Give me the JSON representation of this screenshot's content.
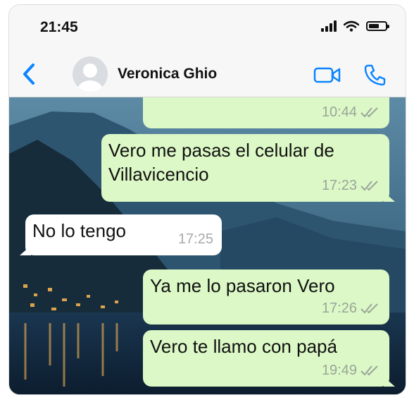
{
  "status_bar": {
    "time": "21:45"
  },
  "header": {
    "contact_name": "Veronica Ghio"
  },
  "colors": {
    "accent": "#0a84ff",
    "outgoing_bubble": "#dcf8c6",
    "incoming_bubble": "#ffffff"
  },
  "icons": [
    "back-chevron-icon",
    "avatar-placeholder-icon",
    "video-call-icon",
    "phone-call-icon",
    "signal-icon",
    "wifi-icon",
    "battery-icon",
    "double-check-icon"
  ],
  "messages": [
    {
      "direction": "out",
      "text": "",
      "time": "10:44",
      "read": true
    },
    {
      "direction": "out",
      "text": "Vero me pasas el celular de Villavicencio",
      "time": "17:23",
      "read": true
    },
    {
      "direction": "in",
      "text": "No lo tengo",
      "time": "17:25"
    },
    {
      "direction": "out",
      "text": "Ya me lo pasaron Vero",
      "time": "17:26",
      "read": true
    },
    {
      "direction": "out",
      "text": "Vero te llamo con papá",
      "time": "19:49",
      "read": true
    }
  ]
}
